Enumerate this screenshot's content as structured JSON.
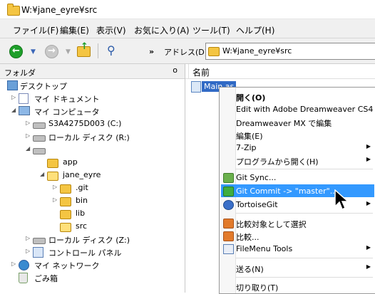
{
  "window": {
    "title": "W:¥jane_eyre¥src"
  },
  "menubar": [
    {
      "label": "ファイル(F)"
    },
    {
      "label": "編集(E)"
    },
    {
      "label": "表示(V)"
    },
    {
      "label": "お気に入り(A)"
    },
    {
      "label": "ツール(T)"
    },
    {
      "label": "ヘルプ(H)"
    }
  ],
  "toolbar": {
    "back_icon": "back-arrow-icon",
    "forward_icon": "forward-arrow-icon",
    "chevron": "»",
    "address_label": "アドレス(D)",
    "address_value": "W:¥jane_eyre¥src"
  },
  "folder_pane": {
    "title": "フォルダ",
    "close_glyph": "o",
    "tree": [
      {
        "label": "デスクトップ",
        "icon": "desktop",
        "expander": ""
      },
      {
        "label": "マイ ドキュメント",
        "icon": "docs",
        "expander": "▷"
      },
      {
        "label": "マイ コンピュータ",
        "icon": "pc",
        "expander": "◢"
      },
      {
        "label": "S3A4275D003 (C:)",
        "icon": "drive",
        "expander": "▷"
      },
      {
        "label": "ローカル ディスク (R:)",
        "icon": "drive",
        "expander": "▷"
      },
      {
        "label": "",
        "icon": "drive",
        "expander": "◢"
      },
      {
        "label": "app",
        "icon": "folder",
        "expander": ""
      },
      {
        "label": "jane_eyre",
        "icon": "folder",
        "expander": "◢"
      },
      {
        "label": ".git",
        "icon": "folder",
        "expander": "▷"
      },
      {
        "label": "bin",
        "icon": "folder",
        "expander": "▷"
      },
      {
        "label": "lib",
        "icon": "folder",
        "expander": ""
      },
      {
        "label": "src",
        "icon": "folder-open",
        "expander": ""
      },
      {
        "label": "ローカル ディスク (Z:)",
        "icon": "drive",
        "expander": "▷"
      },
      {
        "label": "コントロール パネル",
        "icon": "cpanel",
        "expander": "▷"
      },
      {
        "label": "マイ ネットワーク",
        "icon": "net",
        "expander": "▷"
      },
      {
        "label": "ごみ箱",
        "icon": "trash",
        "expander": ""
      }
    ]
  },
  "file_pane": {
    "column_name": "名前",
    "files": [
      {
        "name": "Main.as",
        "icon": "actionscript-file-icon"
      }
    ]
  },
  "context_menu": {
    "items": [
      {
        "label": "開く(O)",
        "bold": true
      },
      {
        "label": "Edit with Adobe Dreamweaver CS4"
      },
      {
        "label": "Dreamweaver MX で編集"
      },
      {
        "label": "編集(E)"
      },
      {
        "label": "7-Zip",
        "submenu": true
      },
      {
        "label": "プログラムから開く(H)",
        "submenu": true
      },
      {
        "label": "Git Sync...",
        "icon": "git-sync"
      },
      {
        "label": "Git Commit -> \"master\"...",
        "icon": "git-commit",
        "highlighted": true
      },
      {
        "label": "TortoiseGit",
        "icon": "tortoisegit",
        "submenu": true
      },
      {
        "label": "比較対象として選択",
        "icon": "compare"
      },
      {
        "label": "比較...",
        "icon": "compare"
      },
      {
        "label": "FileMenu Tools",
        "icon": "filemenu",
        "submenu": true
      },
      {
        "label": "送る(N)",
        "submenu": true
      },
      {
        "label": "切り取り(T)"
      }
    ]
  }
}
